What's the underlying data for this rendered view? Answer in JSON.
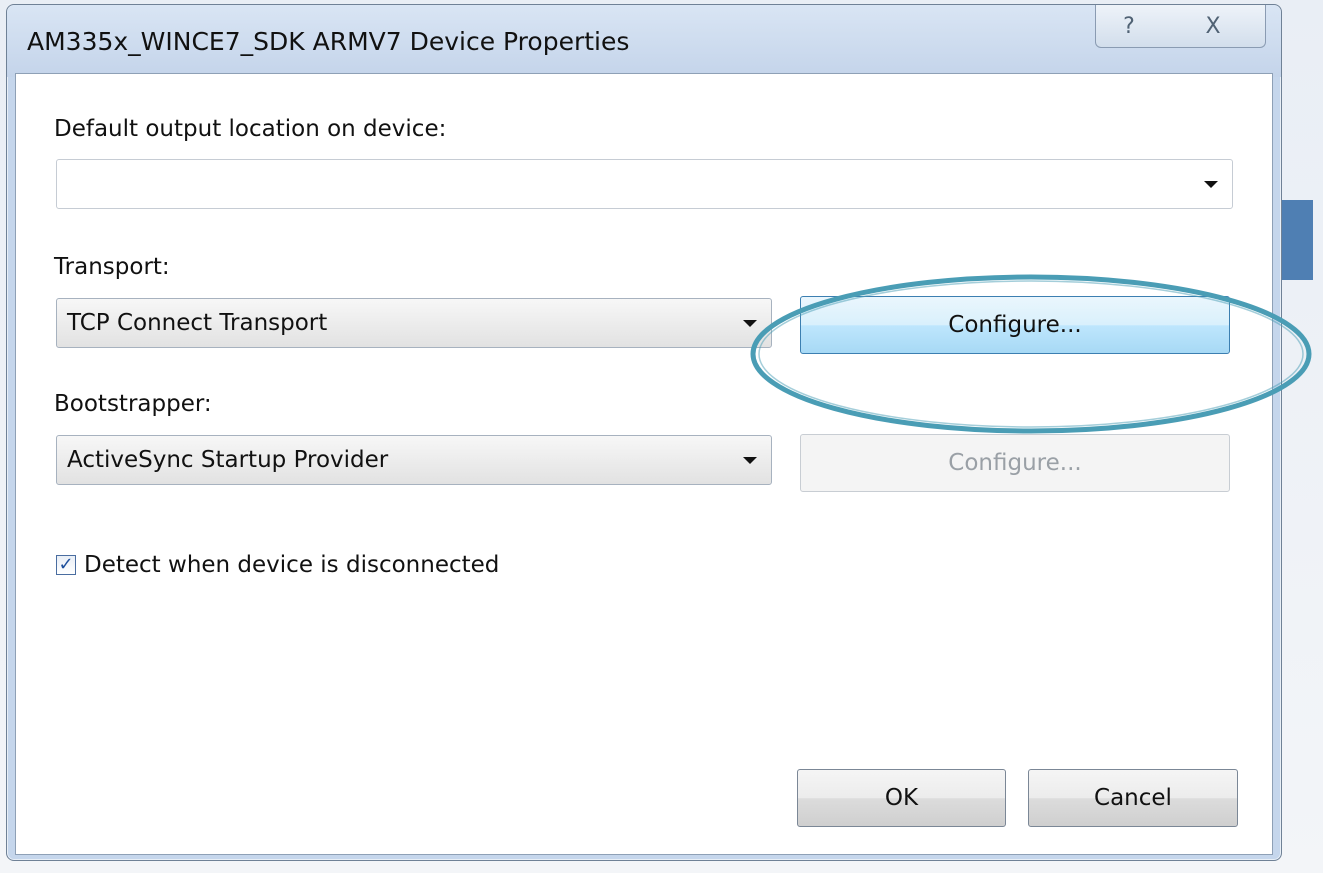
{
  "dialog": {
    "title": "AM335x_WINCE7_SDK ARMV7 Device Properties",
    "help_glyph": "?",
    "close_glyph": "X"
  },
  "output_location": {
    "label": "Default output location on device:",
    "value": ""
  },
  "transport": {
    "label": "Transport:",
    "selected": "TCP Connect Transport",
    "configure_label": "Configure..."
  },
  "bootstrapper": {
    "label": "Bootstrapper:",
    "selected": "ActiveSync Startup Provider",
    "configure_label": "Configure..."
  },
  "detect_disconnect": {
    "label": "Detect when device is disconnected",
    "checked": true,
    "check_glyph": "✓"
  },
  "footer": {
    "ok_label": "OK",
    "cancel_label": "Cancel"
  },
  "colors": {
    "annotation_ring": "#4a9db5",
    "titlebar": "#c5d6ec",
    "hot_button": "#bee6fd"
  }
}
